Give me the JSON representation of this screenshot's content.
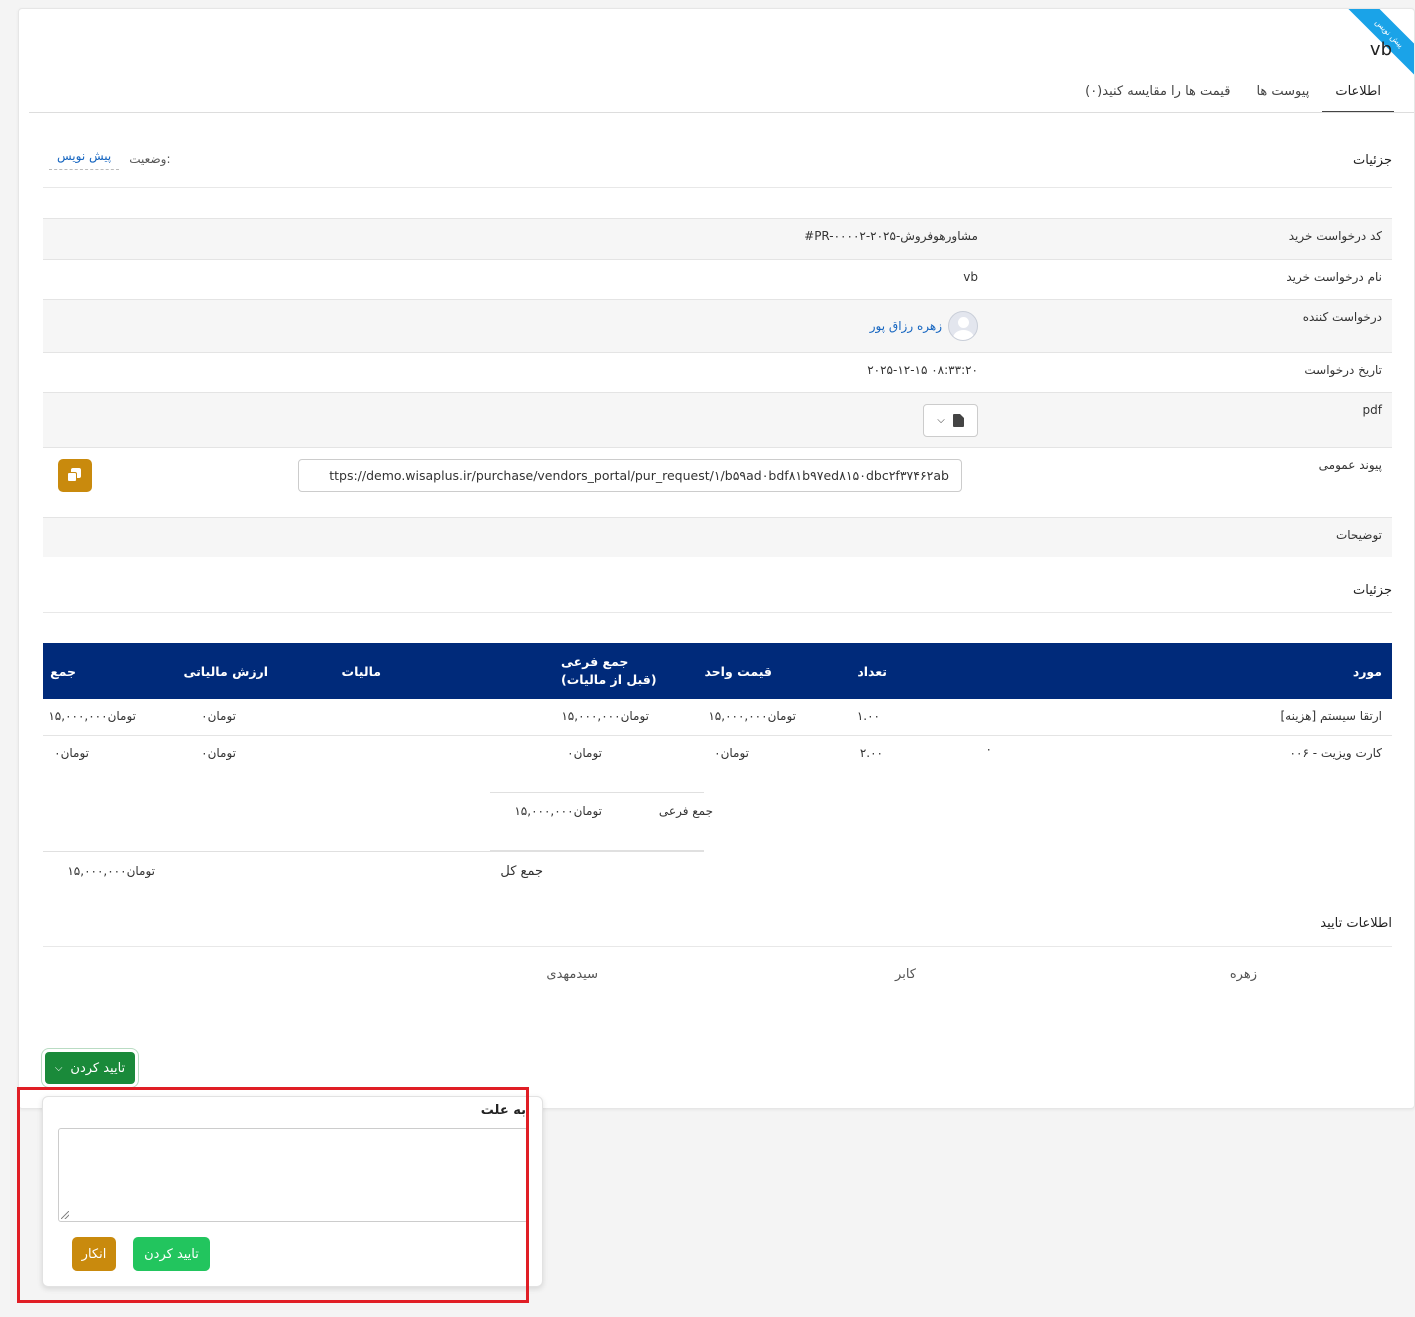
{
  "record": {
    "title": "vb",
    "ribbon": "پیش نویس",
    "status_label": "وضعیت:",
    "status_value": "پیش نویس"
  },
  "tabs": [
    {
      "label": "اطلاعات",
      "active": true
    },
    {
      "label": "پیوست ها",
      "active": false
    },
    {
      "label": "قیمت ها را مقایسه کنید(۰)",
      "active": false
    }
  ],
  "details": {
    "section_title": "جزئیات",
    "fields": {
      "code": {
        "label": "کد درخواست خرید",
        "value": "#PR-۰۰۰۰۲-۲۰۲۵-مشاورهوفروش"
      },
      "name": {
        "label": "نام درخواست خرید",
        "value": "vb"
      },
      "requester": {
        "label": "درخواست کننده",
        "value": "زهره رزاق پور"
      },
      "date": {
        "label": "تاریخ درخواست",
        "value": "۲۰۲۵-۱۲-۱۵ ۰۸:۳۳:۲۰"
      },
      "pdf": {
        "label": "pdf"
      },
      "public_link": {
        "label": "پیوند عمومی",
        "value": "ttps://demo.wisaplus.ir/purchase/vendors_portal/pur_request/۱/b۵۹ad۰bdf۸۱b۹۷ed۸۱۵۰dbc۲f۳۷۴۶۲ab"
      },
      "description": {
        "label": "توضیحات"
      }
    }
  },
  "items": {
    "section_title": "جزئیات",
    "columns": {
      "item": "مورد",
      "qty": "تعداد",
      "unit_price": "قیمت واحد",
      "subtotal": "جمع فرعی (قبل از مالیات)",
      "tax": "مالیات",
      "tax_value": "ارزش مالیاتی",
      "total": "جمع"
    },
    "rows": [
      {
        "item": "[هزینه] ارتقا سیستم",
        "extra": "",
        "qty": "۱.۰۰",
        "unit_price": "۱۵,۰۰۰,۰۰۰تومان",
        "subtotal": "۱۵,۰۰۰,۰۰۰تومان",
        "tax": "",
        "tax_value": "۰تومان",
        "total": "۱۵,۰۰۰,۰۰۰تومان"
      },
      {
        "item": "۰۰۶ - کارت ویزیت",
        "extra": "٠",
        "qty": "۲.۰۰",
        "unit_price": "۰تومان",
        "subtotal": "۰تومان",
        "tax": "",
        "tax_value": "۰تومان",
        "total": "۰تومان"
      }
    ],
    "subtotal": {
      "label": "جمع فرعی",
      "value": "۱۵,۰۰۰,۰۰۰تومان"
    },
    "grand_total": {
      "label": "جمع کل",
      "value": "۱۵,۰۰۰,۰۰۰تومان"
    }
  },
  "approval": {
    "section_title": "اطلاعات تایید",
    "approvers": [
      "زهره",
      "کابر",
      "سیدمهدی"
    ]
  },
  "actions": {
    "approve_dropdown_label": "تایید کردن"
  },
  "popover": {
    "title": "به علت",
    "textarea_value": "",
    "approve_label": "تایید کردن",
    "reject_label": "انکار"
  },
  "colors": {
    "table_header": "#002a7a",
    "approve_dark": "#1a8a3a",
    "approve_light": "#22c55e",
    "reject": "#c98a0d",
    "ribbon": "#1aa3e8",
    "highlight_box": "#e01e25"
  }
}
